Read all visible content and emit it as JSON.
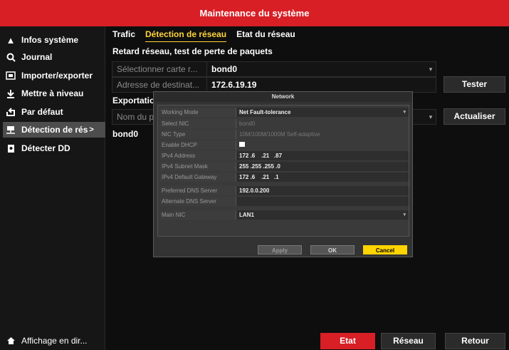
{
  "title": "Maintenance du système",
  "sidebar": {
    "items": [
      {
        "label": "Infos système",
        "icon": "warning-icon"
      },
      {
        "label": "Journal",
        "icon": "search-icon"
      },
      {
        "label": "Importer/exporter",
        "icon": "import-export-icon"
      },
      {
        "label": "Mettre à niveau",
        "icon": "download-icon"
      },
      {
        "label": "Par défaut",
        "icon": "reset-icon"
      },
      {
        "label": "Détection de rés",
        "icon": "network-icon"
      },
      {
        "label": "Détecter DD",
        "icon": "disk-icon"
      }
    ],
    "bottom": "Affichage en dir..."
  },
  "tabs": [
    "Trafic",
    "Détection de réseau",
    "Etat du réseau"
  ],
  "active_tab": 1,
  "section_title": "Retard réseau, test de perte de paquets",
  "select_nic": {
    "label": "Sélectionner carte r...",
    "value": "bond0"
  },
  "dest_address": {
    "label": "Adresse de destinat...",
    "value": "172.6.19.19"
  },
  "test_button": "Tester",
  "export_label": "Exportatio",
  "device_name": {
    "label": "Nom du p"
  },
  "refresh_button": "Actualiser",
  "bond_text": "bond0",
  "dialog": {
    "title": "Network",
    "rows": [
      {
        "label": "Working Mode",
        "value": "Net Fault-tolerance",
        "dropdown": true
      },
      {
        "label": "Select NIC",
        "value": "bond0",
        "dim": true
      },
      {
        "label": "NIC Type",
        "value": "10M/100M/1000M Self-adaptive",
        "dim": true
      },
      {
        "label": "Enable DHCP",
        "value": "",
        "checkbox": true
      },
      {
        "label": "IPv4 Address",
        "value": "172 .6    .21   .87"
      },
      {
        "label": "IPv4 Subnet Mask",
        "value": "255 .255 .255 .0"
      },
      {
        "label": "IPv4 Default Gateway",
        "value": "172 .6    .21   .1"
      },
      {
        "label": "Preferred DNS Server",
        "value": "192.0.0.200"
      },
      {
        "label": "Alternate DNS Server",
        "value": ""
      },
      {
        "label": "Main NIC",
        "value": "LAN1",
        "dropdown": true
      }
    ],
    "apply": "Apply",
    "ok": "OK",
    "cancel": "Cancel"
  },
  "footer": {
    "etat": "Etat",
    "reseau": "Réseau",
    "retour": "Retour"
  },
  "colors": {
    "accent": "#d81f26",
    "highlight": "#ffd43a",
    "cancel": "#ffd400"
  }
}
